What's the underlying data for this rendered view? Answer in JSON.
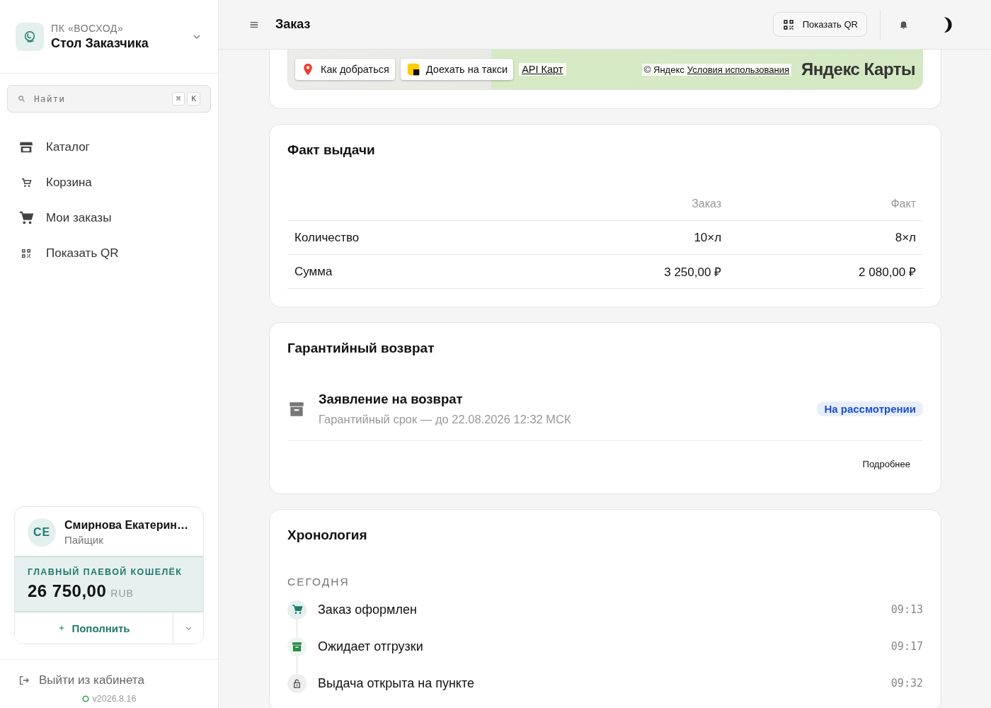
{
  "sidebar": {
    "org": "ПК «ВОСХОД»",
    "app": "Стол Заказчика",
    "search": {
      "placeholder": "Найти",
      "keys": [
        "⌘",
        "K"
      ]
    },
    "items": [
      {
        "kind": "store",
        "label": "Каталог"
      },
      {
        "kind": "cart-small",
        "label": "Корзина"
      },
      {
        "kind": "cart",
        "label": "Мои заказы"
      },
      {
        "kind": "qr",
        "label": "Показать QR"
      }
    ],
    "user": {
      "initials": "СЕ",
      "name": "Смирнова Екатерин…",
      "role": "Пайщик"
    },
    "wallet": {
      "label": "ГЛАВНЫЙ ПАЕВОЙ КОШЕЛЁК",
      "amount": "26 750,00",
      "currency": "RUB",
      "action": "Пополнить"
    },
    "logout": "Выйти из кабинета",
    "version": "v2026.8.16"
  },
  "topbar": {
    "title": "Заказ",
    "qr_button": "Показать QR"
  },
  "map": {
    "route_button": "Как добраться",
    "taxi_button": "Доехать на такси",
    "api_link": "API Карт",
    "copyright": "© Яндекс",
    "terms_link": "Условия использования",
    "logo": "Яндекс Карты"
  },
  "fact": {
    "title": "Факт выдачи",
    "columns": [
      "Заказ",
      "Факт"
    ],
    "rows": [
      {
        "label": "Количество",
        "order": "10×л",
        "fact": "8×л"
      },
      {
        "label": "Сумма",
        "order": "3 250,00 ₽",
        "fact": "2 080,00 ₽"
      }
    ]
  },
  "warranty": {
    "title": "Гарантийный возврат",
    "claim": {
      "title": "Заявление на возврат",
      "subtitle": "Гарантийный срок — до 22.08.2026 12:32 МСК",
      "status": "На рассмотрении"
    },
    "more_link": "Подробнее"
  },
  "timeline": {
    "title": "Хронология",
    "groups": [
      {
        "label": "СЕГОДНЯ",
        "events": [
          {
            "kind": "cart",
            "text": "Заказ оформлен",
            "time": "09:13"
          },
          {
            "kind": "archive",
            "text": "Ожидает отгрузки",
            "time": "09:17"
          },
          {
            "kind": "lock",
            "text": "Выдача открыта на пункте",
            "time": "09:32"
          }
        ]
      }
    ]
  }
}
